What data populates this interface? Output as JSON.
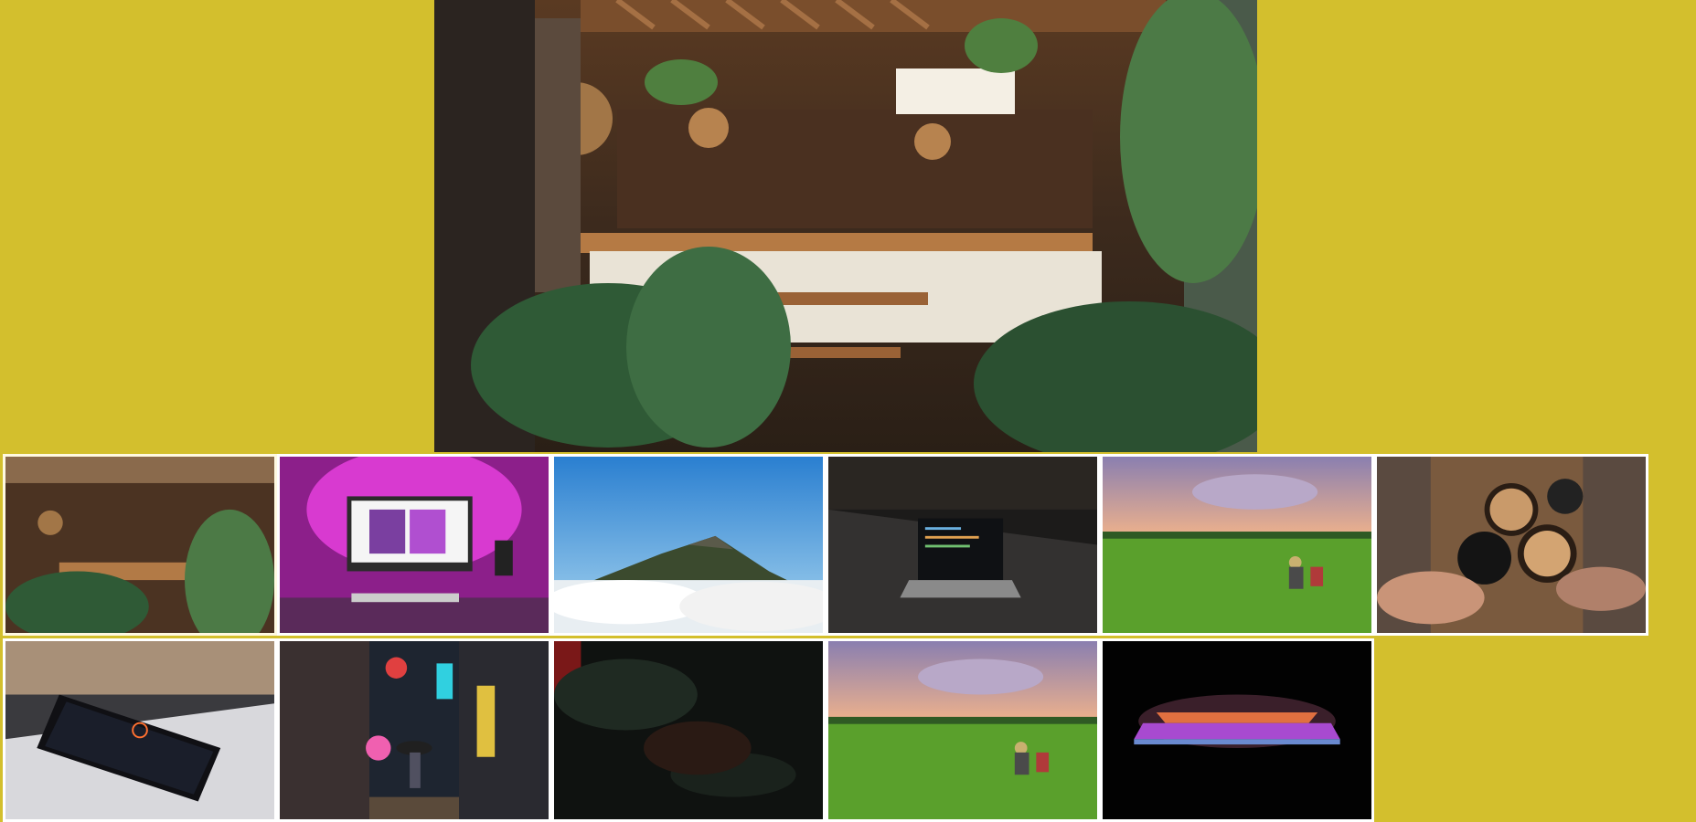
{
  "colors": {
    "background": "#d3bf2d",
    "thumb_border": "#ffffff"
  },
  "gallery": {
    "main_image": {
      "name": "cafe-interior-photo"
    },
    "thumbnails": [
      {
        "name": "cafe-interior-thumb"
      },
      {
        "name": "pink-desk-setup-thumb"
      },
      {
        "name": "mountain-above-clouds-thumb"
      },
      {
        "name": "laptop-code-dark-thumb"
      },
      {
        "name": "rice-field-farmers-thumb"
      },
      {
        "name": "latte-cups-thumb"
      },
      {
        "name": "smartphone-desk-thumb"
      },
      {
        "name": "neon-alley-night-thumb"
      },
      {
        "name": "dark-leaves-thumb"
      },
      {
        "name": "rice-field-farmers-2-thumb"
      },
      {
        "name": "glowing-laptop-thumb"
      }
    ]
  }
}
